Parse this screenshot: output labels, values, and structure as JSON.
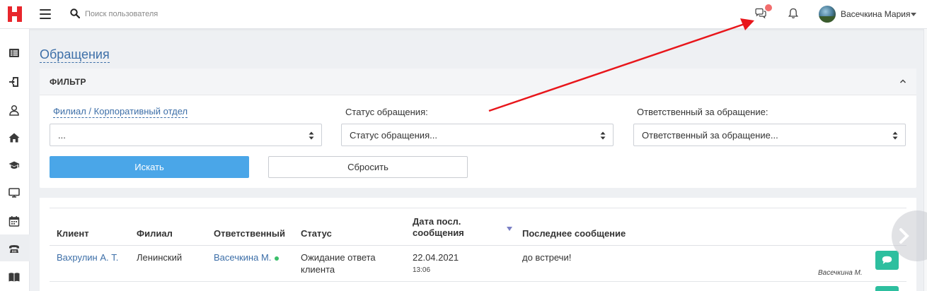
{
  "header": {
    "search_placeholder": "Поиск пользователя",
    "user_name": "Васечкина Мария",
    "brand_color": "#e8262c",
    "notification_dot_color": "#f26d6d"
  },
  "sidebar": {
    "items": [
      {
        "icon": "table-list-icon"
      },
      {
        "icon": "sign-in-icon"
      },
      {
        "icon": "user-icon"
      },
      {
        "icon": "home-icon"
      },
      {
        "icon": "graduation-cap-icon"
      },
      {
        "icon": "monitor-icon"
      },
      {
        "icon": "calendar-icon"
      },
      {
        "icon": "phone-icon",
        "active": true
      },
      {
        "icon": "book-icon"
      }
    ]
  },
  "page": {
    "title": "Обращения"
  },
  "filter": {
    "title": "ФИЛЬТР",
    "branch_label": "Филиал / Корпоративный отдел",
    "branch_value": "...",
    "status_label": "Статус обращения:",
    "status_value": "Статус обращения...",
    "responsible_label": "Ответственный за обращение:",
    "responsible_value": "Ответственный за обращение...",
    "search_button": "Искать",
    "reset_button": "Сбросить",
    "search_button_color": "#4aa6e8"
  },
  "table": {
    "headers": {
      "client": "Клиент",
      "branch": "Филиал",
      "responsible": "Ответственный",
      "status": "Статус",
      "date_line1": "Дата посл.",
      "date_line2": "сообщения",
      "last_message": "Последнее сообщение"
    },
    "rows": [
      {
        "client": "Вахрулин А. Т.",
        "branch": "Ленинский",
        "responsible": "Васечкина М.",
        "status_line1": "Ожидание ответа",
        "status_line2": "клиента",
        "date": "22.04.2021",
        "time": "13:06",
        "message": "до встречи!",
        "author": "Васечкина М."
      }
    ],
    "message_button_color": "#2dbf9f"
  },
  "annotation": {
    "arrow_color": "#e8161b"
  }
}
